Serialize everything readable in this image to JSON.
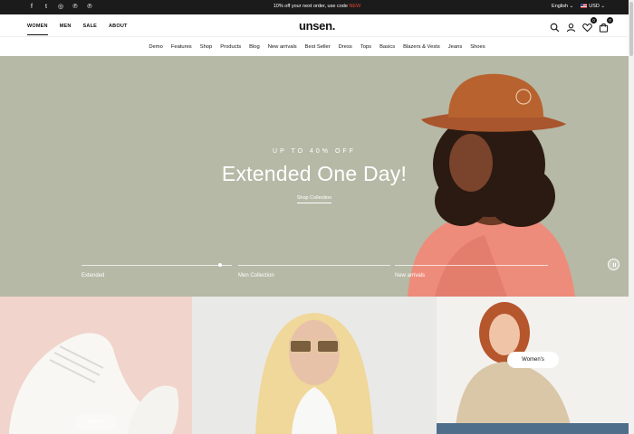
{
  "topbar": {
    "social_icons": [
      "facebook-icon",
      "twitter-icon",
      "instagram-icon",
      "pinterest-icon",
      "pinterest-icon"
    ],
    "promo_text": "10% off your next order, use code",
    "promo_code": "NEW",
    "language": "English",
    "currency": "USD"
  },
  "header": {
    "logo": "unsen.",
    "gender_tabs": [
      "WOMEN",
      "MEN",
      "SALE",
      "ABOUT"
    ],
    "wishlist_count": "0",
    "cart_count": "0"
  },
  "nav": [
    "Demo",
    "Features",
    "Shop",
    "Products",
    "Blog",
    "New arrivals",
    "Best Seller",
    "Dress",
    "Tops",
    "Basics",
    "Blazers & Vests",
    "Jeans",
    "Shoes"
  ],
  "hero": {
    "subtitle": "UP TO 40% OFF",
    "title": "Extended One Day!",
    "button": "Shop Collection",
    "slides": [
      "Extended",
      "Men Collection",
      "New arrivals"
    ],
    "active_slide_progress": 0.92
  },
  "tiles": {
    "shoes_button": "Shoes",
    "women_button": "Women's"
  },
  "colors": {
    "hero_bg": "#b6b9a6",
    "topbar_bg": "#1b1b1b",
    "promo_code": "#e8432e"
  }
}
